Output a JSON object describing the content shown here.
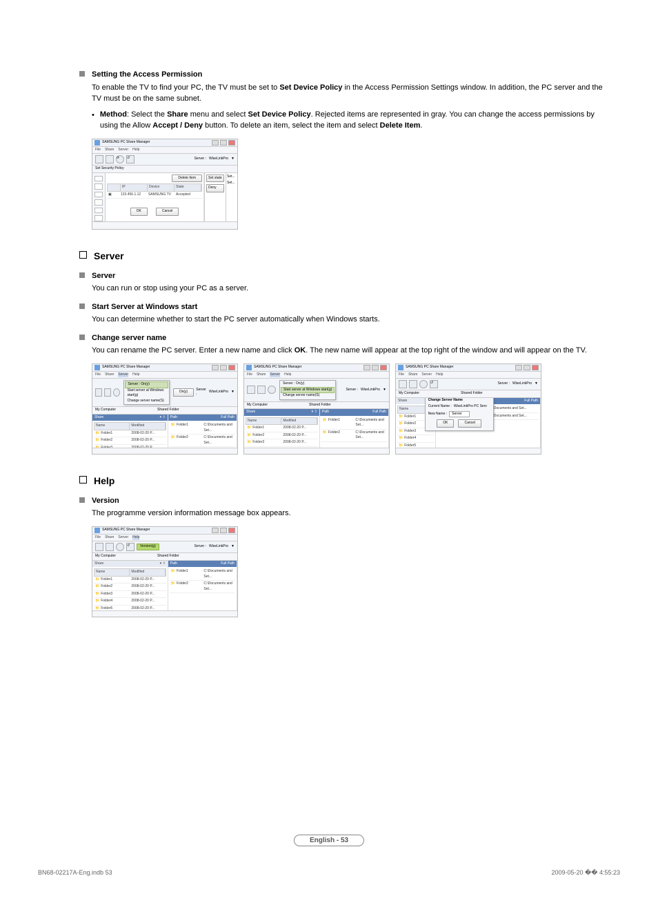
{
  "sections": {
    "access_title": "Setting the Access Permission",
    "access_para": "To enable the TV to find your PC, the TV must be set to ",
    "access_para_bold": "Set Device Policy",
    "access_para_tail": " in the Access Permission Settings window. In addition, the PC server and the TV must be on the same subnet.",
    "method_label": "Method",
    "method_text1": ": Select the ",
    "method_bold1": "Share",
    "method_text2": " menu and select ",
    "method_bold2": "Set Device Policy",
    "method_text3": ". Rejected items are represented in gray. You can change the access permissions by using the Allow ",
    "method_bold3": "Accept / Deny",
    "method_text4": " button. To delete an item, select the item and select ",
    "method_bold4": "Delete Item",
    "method_text5": "."
  },
  "server_section": {
    "heading": "Server",
    "s1_title": "Server",
    "s1_body": "You can run or stop using your PC as a server.",
    "s2_title": "Start Server at Windows start",
    "s2_body": "You can determine whether to start the PC server automatically when Windows starts.",
    "s3_title": "Change server name",
    "s3_body_a": "You can rename the PC server. Enter a new name and click ",
    "s3_body_bold": "OK",
    "s3_body_b": ". The new name will appear at the top right of the window and will appear on the TV."
  },
  "help_section": {
    "heading": "Help",
    "v_title": "Version",
    "v_body": "The programme version information message box appears."
  },
  "app": {
    "title": "SAMSUNG PC Share Manager",
    "menu": [
      "File",
      "Share",
      "Server",
      "Help"
    ],
    "server_label": "Server :",
    "server_name": "WiseLinkPro",
    "my_computer": "My Computer",
    "share": "Share",
    "shared_folder": "Shared Folder",
    "cols": {
      "name": "Name",
      "modified": "Modified",
      "path": "Path",
      "full": "Full Path"
    },
    "folders": [
      {
        "n": "Folder1",
        "m": "2008-02-20 P..."
      },
      {
        "n": "Folder2",
        "m": "2008-02-20 P..."
      },
      {
        "n": "Folder3",
        "m": "2008-02-20 P..."
      },
      {
        "n": "Folder4",
        "m": "2008-02-20 P..."
      },
      {
        "n": "Folder5",
        "m": "2008-02-20 P..."
      }
    ],
    "sf_items": [
      {
        "n": "Folder1",
        "p": "C:\\Documents and Set..."
      },
      {
        "n": "Folder2",
        "p": "C:\\Documents and Set..."
      }
    ],
    "policy": {
      "title": "Set Security Policy",
      "cols": {
        "ip": "IP",
        "device": "Device",
        "state": "State"
      },
      "row": {
        "ip": "123.456.1.12",
        "device": "SAMSUNG TV",
        "state": "Accepted"
      },
      "delete": "Delete Item",
      "set_state": "Set state",
      "set_dots": "Set...",
      "deny": "Deny",
      "ok": "OK",
      "cancel": "Cancel"
    },
    "srv_menu": {
      "i1": "Server : On(y)",
      "i2": "Start server at Windows start(g)",
      "i3": "Change server name(S)",
      "on": "On(y)"
    },
    "change_dlg": {
      "title": "Change Server Name",
      "cur": "Current Name :",
      "cur_v": "WiseLinkPro PC Serv",
      "new": "New Name :",
      "new_v": "Server",
      "ok": "OK",
      "cancel": "Cancel"
    },
    "version_tip": "Version(g)"
  },
  "footer": {
    "left": "BN68-02217A-Eng.indb   53",
    "page": "English - 53",
    "right": "2009-05-20   �� 4:55:23"
  }
}
